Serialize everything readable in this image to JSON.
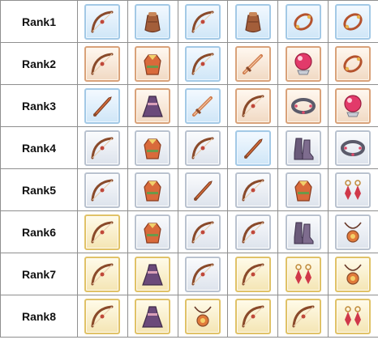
{
  "colors": {
    "blue_frame": "#a3c9e6",
    "bronze_frame": "#d9a27a",
    "silver_frame": "#b9c2cf",
    "gold_frame": "#e0c267",
    "grid_line": "#8f8f8f"
  },
  "ranks": [
    {
      "label": "Rank1",
      "items": [
        {
          "icon": "bow-icon",
          "frame": "blue"
        },
        {
          "icon": "pouch-icon",
          "frame": "blue"
        },
        {
          "icon": "bow-icon",
          "frame": "blue"
        },
        {
          "icon": "pouch-icon",
          "frame": "blue"
        },
        {
          "icon": "bracelet-icon",
          "frame": "blue"
        },
        {
          "icon": "bracelet-icon",
          "frame": "blue"
        }
      ]
    },
    {
      "label": "Rank2",
      "items": [
        {
          "icon": "bow-icon",
          "frame": "bronze"
        },
        {
          "icon": "robe-icon",
          "frame": "bronze"
        },
        {
          "icon": "bow-icon",
          "frame": "blue"
        },
        {
          "icon": "sword-icon",
          "frame": "bronze"
        },
        {
          "icon": "orb-icon",
          "frame": "bronze"
        },
        {
          "icon": "bracelet-icon",
          "frame": "bronze"
        }
      ]
    },
    {
      "label": "Rank3",
      "items": [
        {
          "icon": "dagger-icon",
          "frame": "blue"
        },
        {
          "icon": "dress-icon",
          "frame": "bronze"
        },
        {
          "icon": "sword-icon",
          "frame": "blue"
        },
        {
          "icon": "bow-icon",
          "frame": "bronze"
        },
        {
          "icon": "collar-icon",
          "frame": "bronze"
        },
        {
          "icon": "orb-icon",
          "frame": "bronze"
        }
      ]
    },
    {
      "label": "Rank4",
      "items": [
        {
          "icon": "bow-icon",
          "frame": "silver"
        },
        {
          "icon": "robe-icon",
          "frame": "silver"
        },
        {
          "icon": "bow-icon",
          "frame": "silver"
        },
        {
          "icon": "dagger-icon",
          "frame": "blue"
        },
        {
          "icon": "boots-icon",
          "frame": "silver"
        },
        {
          "icon": "collar-icon",
          "frame": "silver"
        }
      ]
    },
    {
      "label": "Rank5",
      "items": [
        {
          "icon": "bow-icon",
          "frame": "silver"
        },
        {
          "icon": "robe-icon",
          "frame": "silver"
        },
        {
          "icon": "dagger-icon",
          "frame": "silver"
        },
        {
          "icon": "bow-icon",
          "frame": "silver"
        },
        {
          "icon": "robe-icon",
          "frame": "silver"
        },
        {
          "icon": "earring-icon",
          "frame": "silver"
        }
      ]
    },
    {
      "label": "Rank6",
      "items": [
        {
          "icon": "bow-icon",
          "frame": "gold"
        },
        {
          "icon": "robe-icon",
          "frame": "silver"
        },
        {
          "icon": "bow-icon",
          "frame": "silver"
        },
        {
          "icon": "bow-icon",
          "frame": "silver"
        },
        {
          "icon": "boots-icon",
          "frame": "silver"
        },
        {
          "icon": "pendant-icon",
          "frame": "silver"
        }
      ]
    },
    {
      "label": "Rank7",
      "items": [
        {
          "icon": "bow-icon",
          "frame": "gold"
        },
        {
          "icon": "dress-icon",
          "frame": "gold"
        },
        {
          "icon": "bow-icon",
          "frame": "silver"
        },
        {
          "icon": "bow-icon",
          "frame": "gold"
        },
        {
          "icon": "earring-icon",
          "frame": "gold"
        },
        {
          "icon": "pendant-icon",
          "frame": "gold"
        }
      ]
    },
    {
      "label": "Rank8",
      "items": [
        {
          "icon": "bow-icon",
          "frame": "gold"
        },
        {
          "icon": "dress-icon",
          "frame": "gold"
        },
        {
          "icon": "pendant-icon",
          "frame": "gold"
        },
        {
          "icon": "bow-icon",
          "frame": "gold"
        },
        {
          "icon": "bow-icon",
          "frame": "gold"
        },
        {
          "icon": "earring-icon",
          "frame": "gold"
        }
      ]
    }
  ]
}
